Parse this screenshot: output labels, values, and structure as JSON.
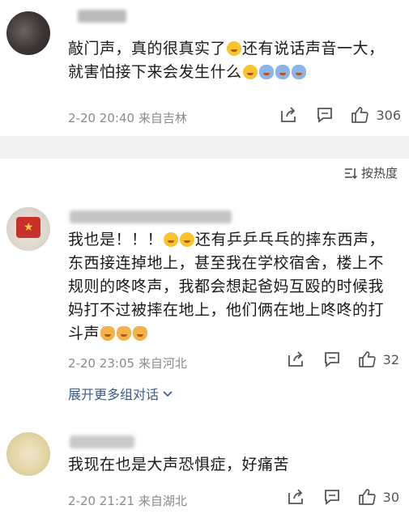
{
  "comments": [
    {
      "text": "敲门声，真的很真实了😭还有说话声音一大，就害怕接下来会发生什么😭🙇🙇🙇",
      "date": "2-20 20:40",
      "location": "来自吉林",
      "likes": "306"
    },
    {
      "text": "我也是！！！😭😭还有乒乒乓乓的摔东西声，东西接连掉地上，甚至我在学校宿舍，楼上不规则的咚咚声，我都会想起爸妈互殴的时候我妈打不过被摔在地上，他们俩在地上咚咚的打斗声😿😿😿",
      "date": "2-20 23:05",
      "location": "来自河北",
      "likes": "32",
      "expand_label": "展开更多组对话"
    },
    {
      "text": "我现在也是大声恐惧症，好痛苦",
      "date": "2-20 21:21",
      "location": "来自湖北",
      "likes": "30"
    }
  ],
  "sort_label": "按热度",
  "icons": [
    "share-icon",
    "comment-icon",
    "like-icon",
    "sort-icon",
    "chevron-down-icon"
  ],
  "colors": {
    "link": "#3b5b8c",
    "meta": "#8a8a8a",
    "band": "#f2f2f2"
  }
}
